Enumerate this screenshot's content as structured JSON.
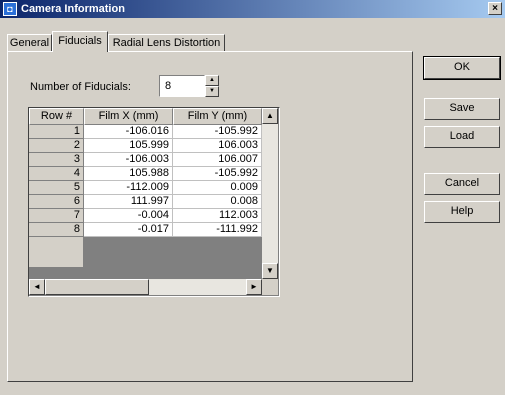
{
  "window": {
    "title": "Camera Information",
    "close_glyph": "×"
  },
  "tabs": [
    {
      "label": "General",
      "active": false
    },
    {
      "label": "Fiducials",
      "active": true
    },
    {
      "label": "Radial Lens Distortion",
      "active": false
    }
  ],
  "fiducials": {
    "count_label": "Number of Fiducials:",
    "count_value": "8",
    "columns": [
      "Row #",
      "Film X (mm)",
      "Film Y (mm)"
    ],
    "rows": [
      {
        "row": "1",
        "x": "-106.016",
        "y": "-105.992"
      },
      {
        "row": "2",
        "x": "105.999",
        "y": "106.003"
      },
      {
        "row": "3",
        "x": "-106.003",
        "y": "106.007"
      },
      {
        "row": "4",
        "x": "105.988",
        "y": "-105.992"
      },
      {
        "row": "5",
        "x": "-112.009",
        "y": "0.009"
      },
      {
        "row": "6",
        "x": "111.997",
        "y": "0.008"
      },
      {
        "row": "7",
        "x": "-0.004",
        "y": "112.003"
      },
      {
        "row": "8",
        "x": "-0.017",
        "y": "-111.992"
      }
    ]
  },
  "buttons": {
    "ok": "OK",
    "save": "Save",
    "load": "Load",
    "cancel": "Cancel",
    "help": "Help"
  },
  "glyphs": {
    "spin_up": "▲",
    "spin_down": "▼",
    "scroll_up": "▲",
    "scroll_down": "▼",
    "scroll_left": "◄",
    "scroll_right": "►",
    "app_icon": "◘"
  },
  "colors": {
    "title_bar_start": "#0a246a",
    "title_bar_end": "#a6caf0",
    "face": "#d4d0c8"
  }
}
